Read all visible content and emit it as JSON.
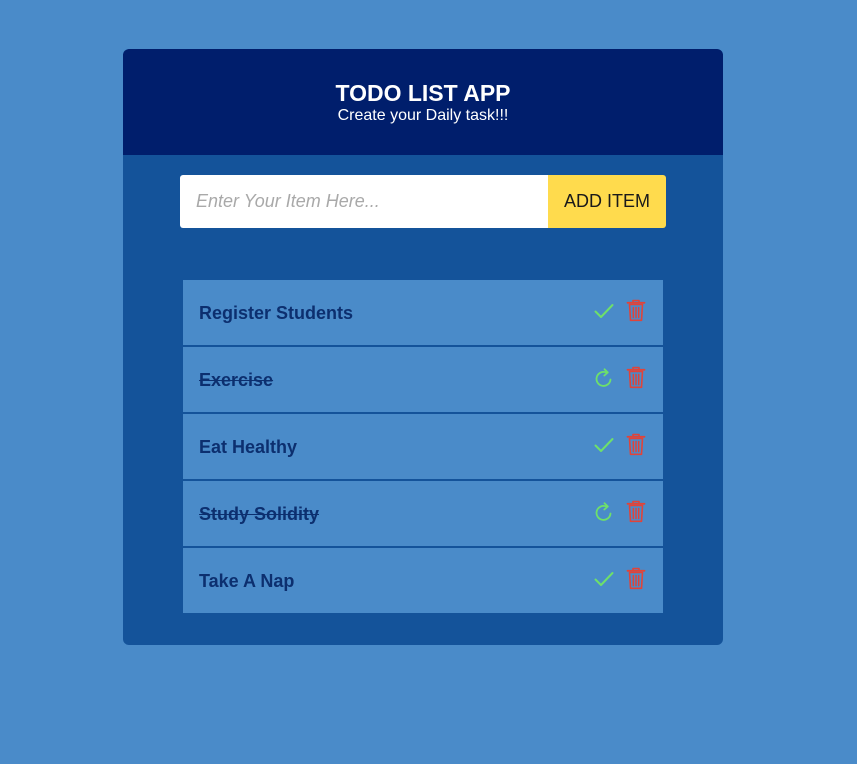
{
  "header": {
    "title": "TODO LIST APP",
    "subtitle": "Create your Daily task!!!"
  },
  "form": {
    "input_placeholder": "Enter Your Item Here...",
    "input_value": "",
    "add_button_label": "ADD ITEM"
  },
  "colors": {
    "background": "#4a8bc9",
    "panel": "#14539a",
    "header": "#001e6c",
    "add_button": "#ffdb4d",
    "check_icon": "#6ee06a",
    "trash_icon": "#e0443a"
  },
  "todos": [
    {
      "text": "Register Students",
      "completed": false,
      "toggle_icon": "check-icon"
    },
    {
      "text": "Exercise",
      "completed": true,
      "toggle_icon": "redo-icon"
    },
    {
      "text": "Eat Healthy",
      "completed": false,
      "toggle_icon": "check-icon"
    },
    {
      "text": "Study Solidity",
      "completed": true,
      "toggle_icon": "redo-icon"
    },
    {
      "text": "Take A Nap",
      "completed": false,
      "toggle_icon": "check-icon"
    }
  ]
}
